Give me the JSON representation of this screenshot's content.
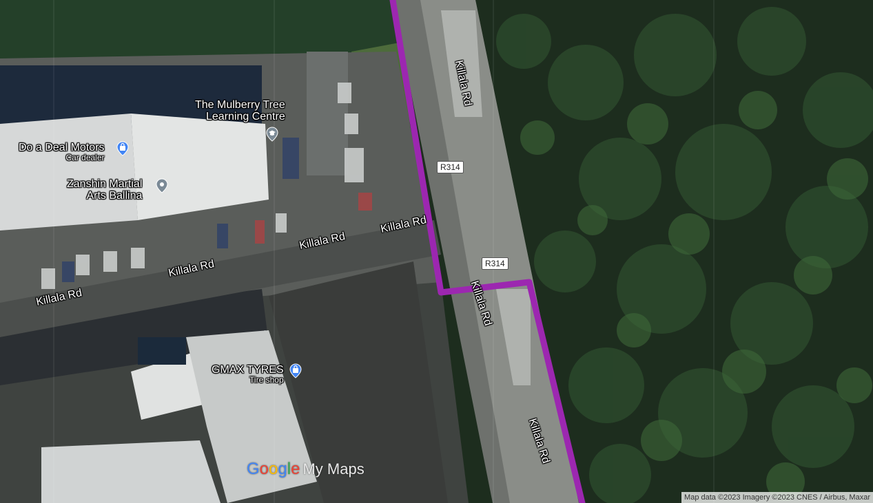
{
  "map": {
    "pois": [
      {
        "name_lines": [
          "The Mulberry Tree",
          "Learning Centre"
        ],
        "category": "",
        "icon": "school-icon"
      },
      {
        "name_lines": [
          "Do a Deal Motors"
        ],
        "category": "Car dealer",
        "icon": "shopping-bag-icon"
      },
      {
        "name_lines": [
          "Zanshin Martial",
          "Arts Ballina"
        ],
        "category": "",
        "icon": "map-pin-icon"
      },
      {
        "name_lines": [
          "GMAX TYRES"
        ],
        "category": "Tire shop",
        "icon": "shopping-bag-icon"
      }
    ],
    "road_labels": [
      "Killala Rd",
      "Killala Rd",
      "Killala Rd",
      "Killala Rd",
      "Killala Rd",
      "Killala Rd",
      "Killala Rd"
    ],
    "route_shields": [
      "R314",
      "R314"
    ],
    "route_color": "#9c27b0",
    "brand": {
      "google": "Google",
      "mymaps": "My Maps"
    },
    "attribution": "Map data ©2023 Imagery ©2023 CNES / Airbus, Maxar"
  }
}
